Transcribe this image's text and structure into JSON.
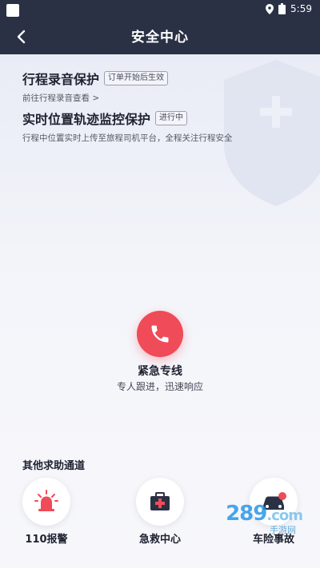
{
  "status_bar": {
    "time": "5:59"
  },
  "nav": {
    "title": "安全中心"
  },
  "features": [
    {
      "name": "行程录音保护",
      "tag": "订单开始后生效",
      "sub": "前往行程录音查看 >"
    },
    {
      "name": "实时位置轨迹监控保护",
      "tag": "进行中",
      "sub": "行程中位置实时上传至旅程司机平台，全程关注行程安全"
    }
  ],
  "emergency": {
    "title": "紧急专线",
    "subtitle": "专人跟进，迅速响应"
  },
  "other": {
    "title": "其他求助通道",
    "channels": [
      {
        "label": "110报警",
        "icon": "police-siren-icon"
      },
      {
        "label": "急救中心",
        "icon": "first-aid-kit-icon"
      },
      {
        "label": "车险事故",
        "icon": "car-accident-icon"
      }
    ]
  },
  "watermark": {
    "brand": "289",
    "suffix": ".com",
    "sub": "手游网"
  },
  "colors": {
    "header": "#2a3145",
    "accent_red": "#f04b58"
  }
}
